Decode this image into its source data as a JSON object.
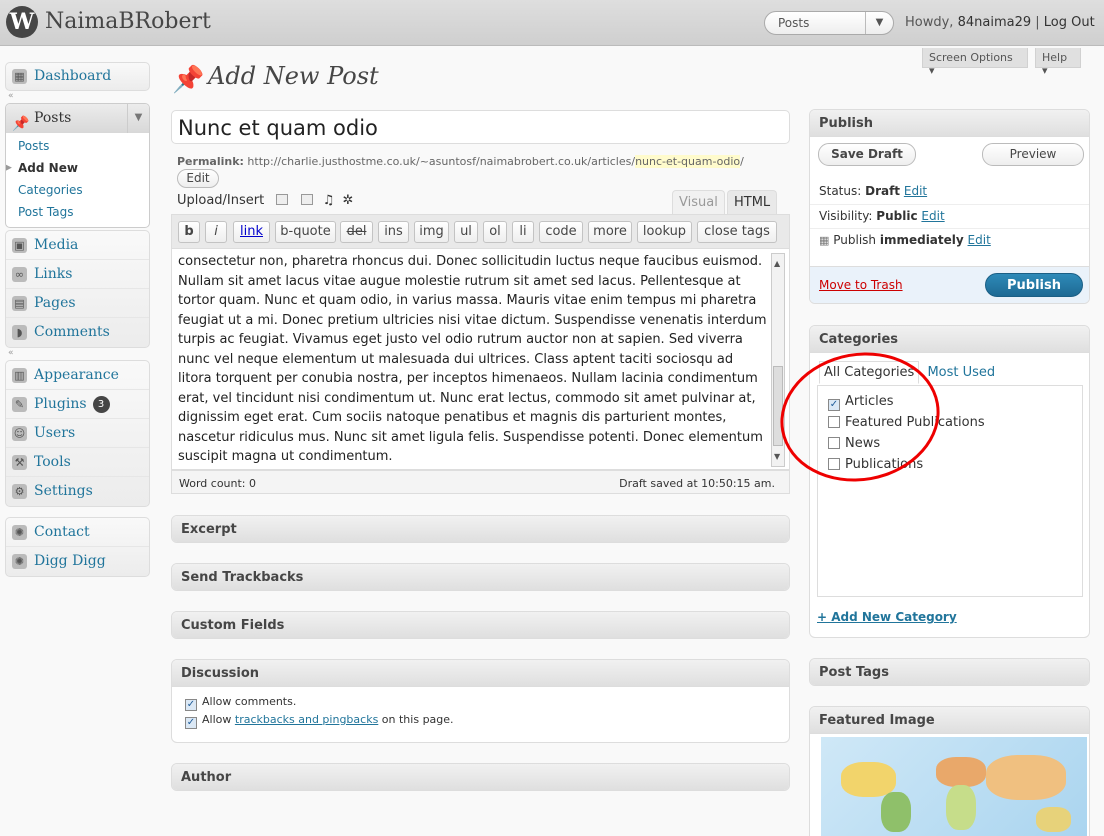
{
  "header": {
    "logo": "W",
    "site_name": "NaimaBRobert",
    "favorites_selected": "Posts",
    "howdy_prefix": "Howdy,",
    "username": "84naima29",
    "separator": "|",
    "logout": "Log Out"
  },
  "screen_tabs": {
    "screen_options": "Screen Options ▾",
    "help": "Help ▾"
  },
  "sidebar": {
    "dashboard": "Dashboard",
    "posts": "Posts",
    "posts_sub": [
      "Posts",
      "Add New",
      "Categories",
      "Post Tags"
    ],
    "group2": [
      "Media",
      "Links",
      "Pages",
      "Comments"
    ],
    "group3": [
      "Appearance",
      "Plugins",
      "Users",
      "Tools",
      "Settings"
    ],
    "plugins_badge": "3",
    "group4": [
      "Contact",
      "Digg Digg"
    ]
  },
  "page_title": "Add New Post",
  "post": {
    "title": "Nunc et quam odio",
    "permalink_label": "Permalink:",
    "permalink_base": "http://charlie.justhostme.co.uk/~asuntosf/naimabrobert.co.uk/articles/",
    "permalink_slug": "nunc-et-quam-odio",
    "permalink_end": "/",
    "edit_label": "Edit",
    "upload_insert": "Upload/Insert",
    "tab_visual": "Visual",
    "tab_html": "HTML",
    "quicktags": [
      "b",
      "i",
      "link",
      "b-quote",
      "del",
      "ins",
      "img",
      "ul",
      "ol",
      "li",
      "code",
      "more",
      "lookup",
      "close tags"
    ],
    "content": "consectetur non, pharetra rhoncus dui. Donec sollicitudin luctus neque faucibus euismod. Nullam sit amet lacus vitae augue molestie rutrum sit amet sed lacus. Pellentesque at tortor quam. Nunc et quam odio, in varius massa. Mauris vitae enim tempus mi pharetra feugiat ut a mi. Donec pretium ultricies nisi vitae dictum. Suspendisse venenatis interdum turpis ac feugiat. Vivamus eget justo vel odio rutrum auctor non at sapien. Sed viverra nunc vel neque elementum ut malesuada dui ultrices. Class aptent taciti sociosqu ad litora torquent per conubia nostra, per inceptos himenaeos. Nullam lacinia condimentum erat, vel tincidunt nisi condimentum ut. Nunc erat lectus, commodo sit amet pulvinar at, dignissim eget erat. Cum sociis natoque penatibus et magnis dis parturient montes, nascetur ridiculus mus. Nunc sit amet ligula felis. Suspendisse potenti. Donec elementum suscipit magna ut condimentum.",
    "word_count": "Word count: 0",
    "draft_saved": "Draft saved at 10:50:15 am."
  },
  "boxes": {
    "excerpt": "Excerpt",
    "trackbacks": "Send Trackbacks",
    "custom_fields": "Custom Fields",
    "discussion": "Discussion",
    "allow_comments": "Allow comments.",
    "allow_prefix": "Allow",
    "trackbacks_link": "trackbacks and pingbacks",
    "allow_suffix": "on this page.",
    "author": "Author"
  },
  "publish": {
    "title": "Publish",
    "save_draft": "Save Draft",
    "preview": "Preview",
    "status_label": "Status:",
    "status_value": "Draft",
    "visibility_label": "Visibility:",
    "visibility_value": "Public",
    "publish_label": "Publish",
    "publish_value": "immediately",
    "edit": "Edit",
    "move_to_trash": "Move to Trash",
    "publish_button": "Publish"
  },
  "categories": {
    "title": "Categories",
    "tab_all": "All Categories",
    "tab_most": "Most Used",
    "items": [
      {
        "label": "Articles",
        "checked": true
      },
      {
        "label": "Featured Publications",
        "checked": false
      },
      {
        "label": "News",
        "checked": false
      },
      {
        "label": "Publications",
        "checked": false
      }
    ],
    "add_new": "+ Add New Category"
  },
  "post_tags": {
    "title": "Post Tags"
  },
  "featured_image": {
    "title": "Featured Image"
  },
  "colors": {
    "accent": "#21759b",
    "publish_button": "#21759b",
    "annotation": "#e00000"
  }
}
